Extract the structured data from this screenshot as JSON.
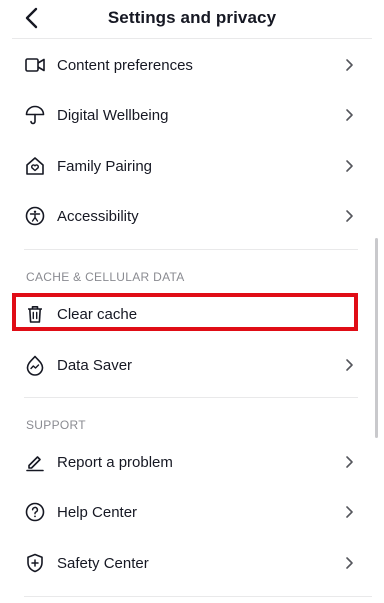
{
  "header": {
    "title": "Settings and privacy"
  },
  "items_top": [
    {
      "label": "Content preferences",
      "icon": "video-icon",
      "chevron": true
    },
    {
      "label": "Digital Wellbeing",
      "icon": "umbrella-icon",
      "chevron": true
    },
    {
      "label": "Family Pairing",
      "icon": "home-heart-icon",
      "chevron": true
    },
    {
      "label": "Accessibility",
      "icon": "accessibility-icon",
      "chevron": true
    }
  ],
  "cache_section": {
    "title": "CACHE & CELLULAR DATA",
    "items": [
      {
        "label": "Clear cache",
        "icon": "trash-icon",
        "chevron": false,
        "highlighted": true
      },
      {
        "label": "Data Saver",
        "icon": "data-saver-icon",
        "chevron": true
      }
    ]
  },
  "support_section": {
    "title": "SUPPORT",
    "items": [
      {
        "label": "Report a problem",
        "icon": "pencil-icon",
        "chevron": true
      },
      {
        "label": "Help Center",
        "icon": "help-icon",
        "chevron": true
      },
      {
        "label": "Safety Center",
        "icon": "shield-plus-icon",
        "chevron": true
      }
    ]
  },
  "colors": {
    "highlight": "#e00d16",
    "text": "#161823",
    "muted": "#8a8b91",
    "divider": "#e9e9ea"
  }
}
